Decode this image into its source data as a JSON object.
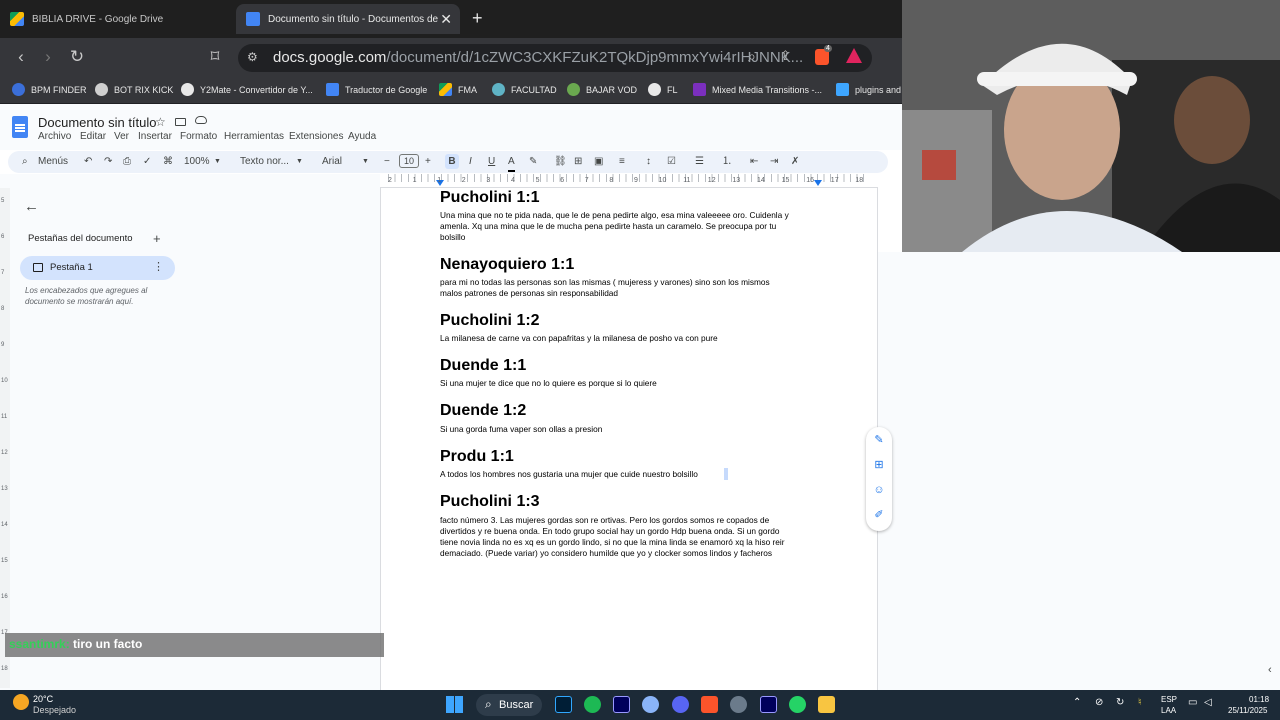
{
  "browser": {
    "tabs": [
      {
        "label": "BIBLIA DRIVE - Google Drive",
        "active": false
      },
      {
        "label": "Documento sin título - Documentos de Goo",
        "active": true
      }
    ],
    "url": {
      "host": "docs.google.com",
      "path": "/document/d/1cZWC3CXKFZuK2TQkDjp9mmxYwi4rIHJNNK..."
    },
    "extension_badge": "4",
    "bookmarks": [
      "BPM FINDER",
      "BOT RIX KICK",
      "Y2Mate - Convertidor de Y...",
      "Traductor de Google",
      "FMA",
      "FACULTAD",
      "BAJAR VOD",
      "FL",
      "Mixed Media Transitions -...",
      "plugins and"
    ]
  },
  "docs": {
    "title": "Documento sin título",
    "menu": [
      "Archivo",
      "Editar",
      "Ver",
      "Insertar",
      "Formato",
      "Herramientas",
      "Extensiones",
      "Ayuda"
    ],
    "toolbar": {
      "search": "Menús",
      "zoom": "100%",
      "style": "Texto nor...",
      "font": "Arial",
      "font_size": "10"
    },
    "ruler_marks": [
      "2",
      "1",
      "1",
      "2",
      "3",
      "4",
      "5",
      "6",
      "7",
      "8",
      "9",
      "10",
      "11",
      "12",
      "13",
      "14",
      "15",
      "16",
      "17",
      "18"
    ],
    "left_ruler_marks": [
      "5",
      "6",
      "7",
      "8",
      "9",
      "10",
      "11",
      "12",
      "13",
      "14",
      "15",
      "16",
      "17",
      "18"
    ],
    "sidebar": {
      "header": "Pestañas del documento",
      "tab": "Pestaña 1",
      "hint_line1": "Los encabezados que agregues al",
      "hint_line2": "documento se mostrarán aquí."
    }
  },
  "document": {
    "sections": [
      {
        "heading": "Pucholini 1:1",
        "lines": [
          "Una mina que no te pida nada, que le de pena pedirte algo, esa mina valeeeee oro. Cuidenla y",
          "amenla. Xq una mina que le de mucha pena pedirte hasta un caramelo. Se preocupa por tu",
          "bolsillo"
        ]
      },
      {
        "heading": "Nenayoquiero 1:1",
        "lines": [
          " para mi no todas las personas son las mismas ( mujeress y varones) sino son los mismos",
          "malos patrones de personas sin responsabilidad"
        ]
      },
      {
        "heading": "Pucholini 1:2",
        "lines": [
          "La milanesa de carne va con papafritas y la milanesa de posho va con pure"
        ]
      },
      {
        "heading": "Duende 1:1",
        "lines": [
          "Si una mujer te dice que no lo quiere es porque si lo quiere"
        ]
      },
      {
        "heading": "Duende 1:2",
        "lines": [
          "Si una gorda fuma vaper son ollas a presion"
        ]
      },
      {
        "heading": "Produ 1:1",
        "lines": [
          "A todos los hombres nos gustaria una mujer que cuide nuestro bolsillo"
        ]
      },
      {
        "heading": "Pucholini 1:3",
        "lines": [
          "facto número 3. Las mujeres gordas son re ortivas. Pero los gordos somos re copados de",
          "divertidos y re buena onda. En todo grupo social hay un gordo Hdp buena onda. Si un gordo",
          "tiene novia linda no es xq es un gordo lindo, si no que la mina linda se enamoró xq la hiso reir",
          "demaciado. (Puede variar) yo considero humilde que yo y clocker somos lindos y facheros"
        ]
      }
    ]
  },
  "chat": {
    "user": "ssantimrk:",
    "message": "tiro un facto"
  },
  "taskbar": {
    "weather_temp": "20°C",
    "weather_desc": "Despejado",
    "search": "Buscar",
    "lang1": "ESP",
    "lang2": "LAA",
    "time": "01:18",
    "date": "25/11/2025"
  },
  "colors": {
    "docs_blue": "#1a73e8",
    "accent_green": "#34d058"
  }
}
